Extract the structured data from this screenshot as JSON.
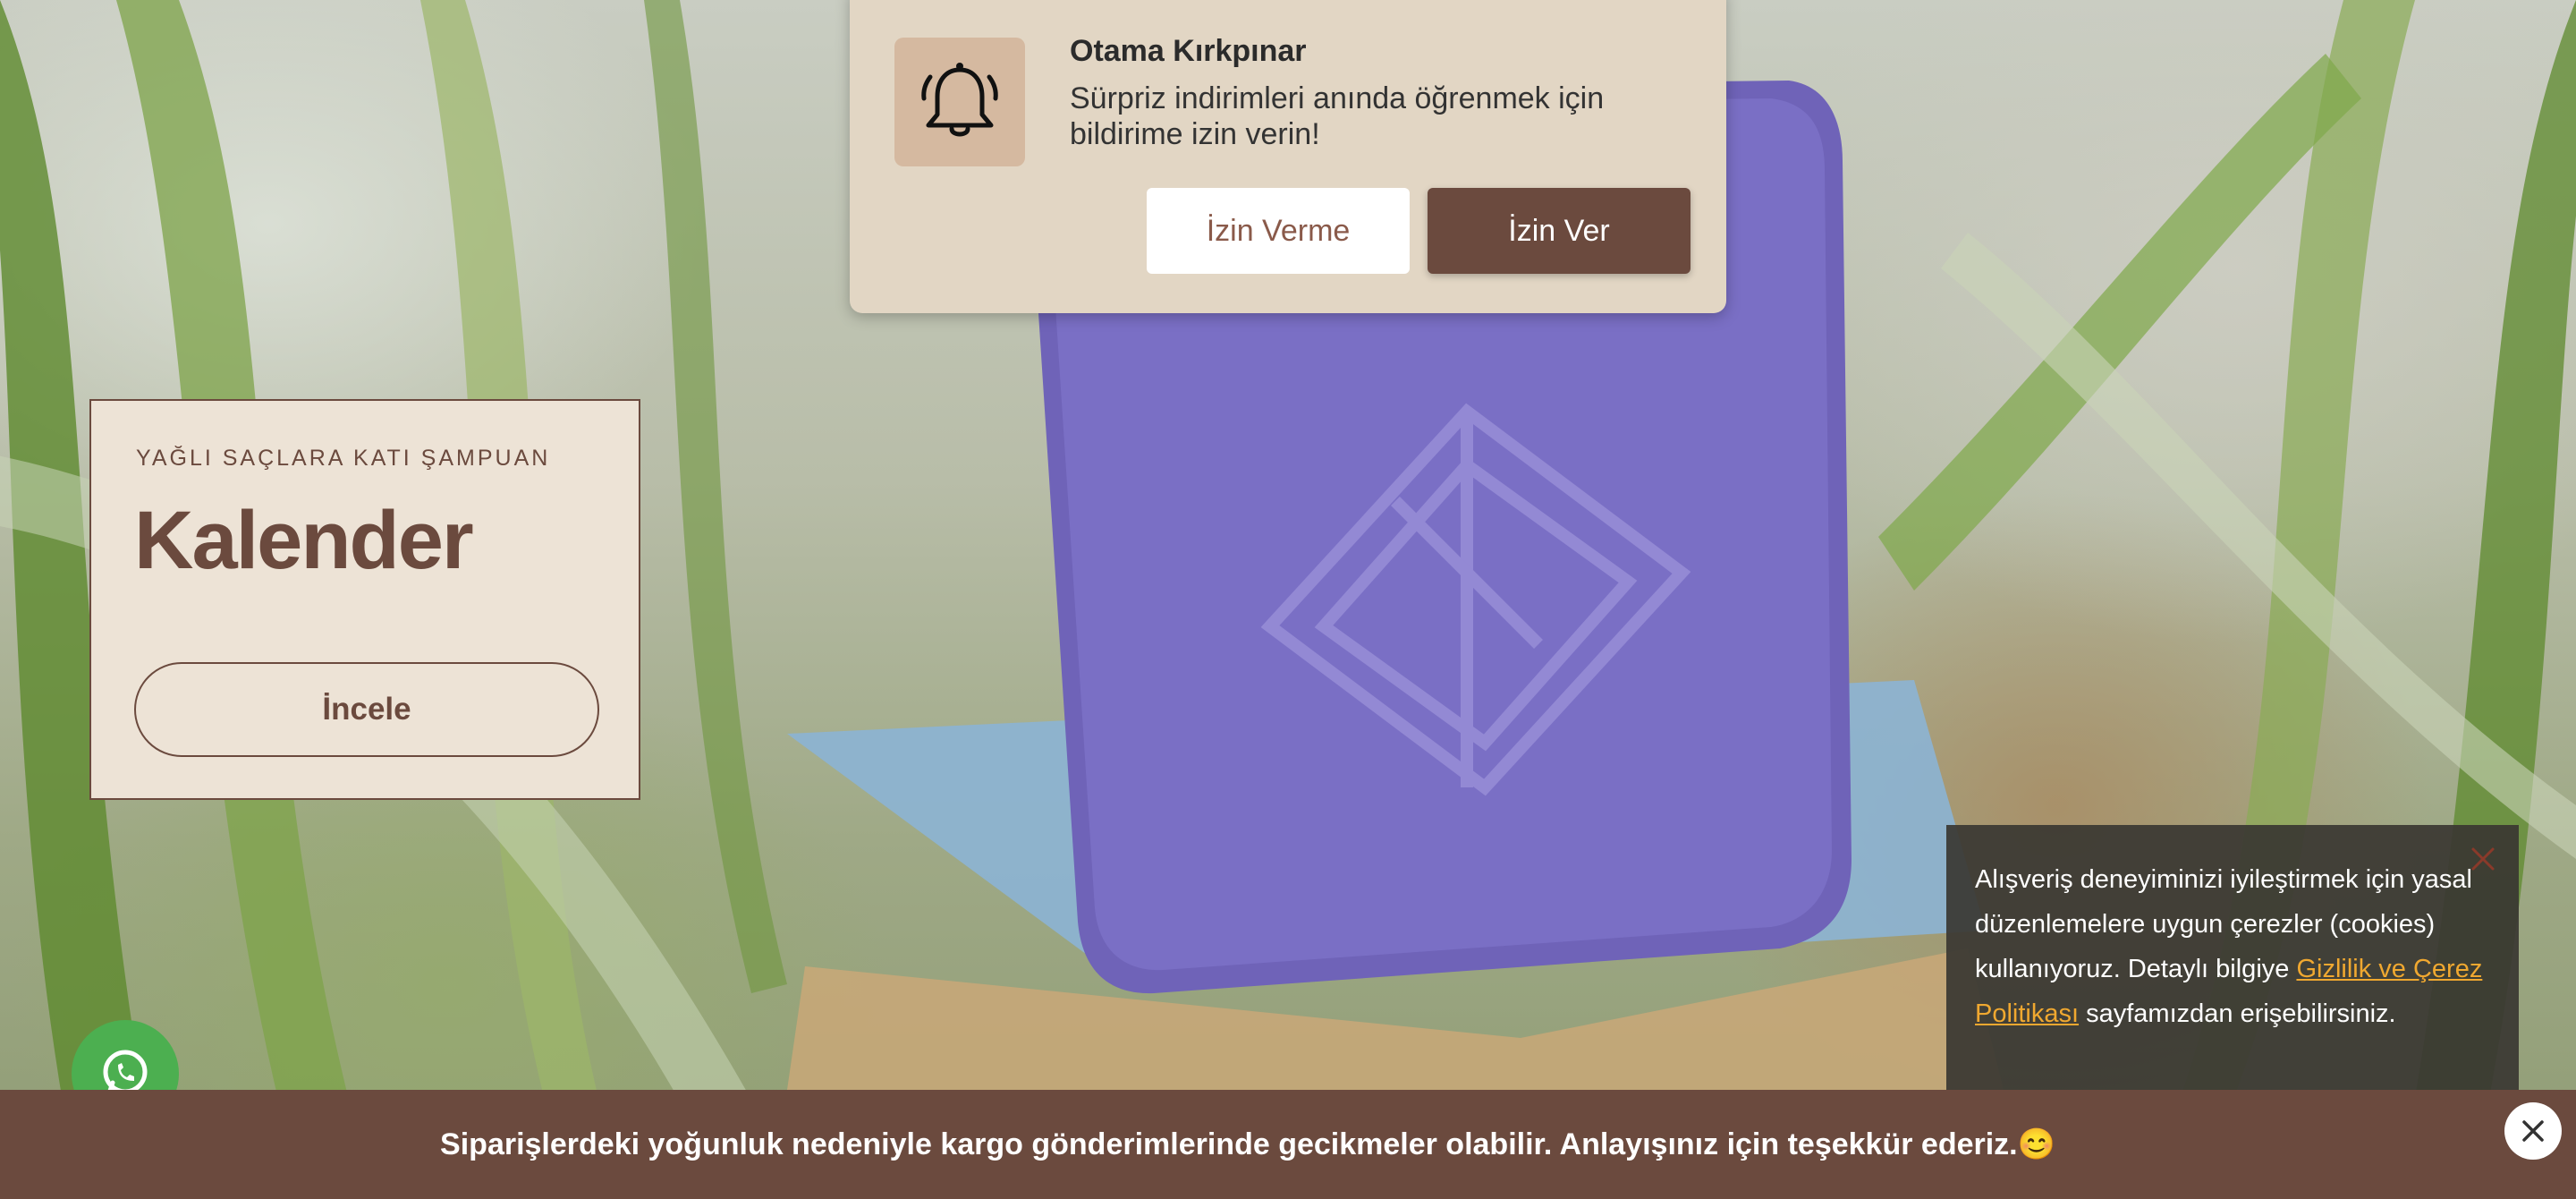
{
  "notification": {
    "icon": "bell-icon",
    "title": "Otama Kırkpınar",
    "message": "Sürpriz indirimleri anında öğrenmek için bildirime izin verin!",
    "deny_label": "İzin Verme",
    "allow_label": "İzin Ver"
  },
  "hero_card": {
    "eyebrow": "YAĞLI SAÇLARA KATI ŞAMPUAN",
    "title": "Kalender",
    "button_label": "İncele"
  },
  "cookie_banner": {
    "text_before_link": "Alışveriş deneyiminizi iyileştirmek için yasal düzenlemelere uygun çerezler (cookies) kullanıyoruz. Detaylı bilgiye ",
    "link_text": "Gizlilik ve Çerez Politikası",
    "text_after_link": " sayfamızdan erişebilirsiniz.",
    "close_icon": "close-icon"
  },
  "announcement_bar": {
    "text": "Siparişlerdeki yoğunluk nedeniyle kargo gönderimlerinde gecikmeler olabilir. Anlayışınız için teşekkür ederiz.😊",
    "close_icon": "close-icon"
  },
  "whatsapp": {
    "icon": "whatsapp-icon"
  },
  "colors": {
    "brand_brown": "#6b4a3e",
    "card_bg": "#ede3d6",
    "popup_bg": "#e2d6c4",
    "link_orange": "#f0a830",
    "whatsapp_green": "#4caf50"
  }
}
